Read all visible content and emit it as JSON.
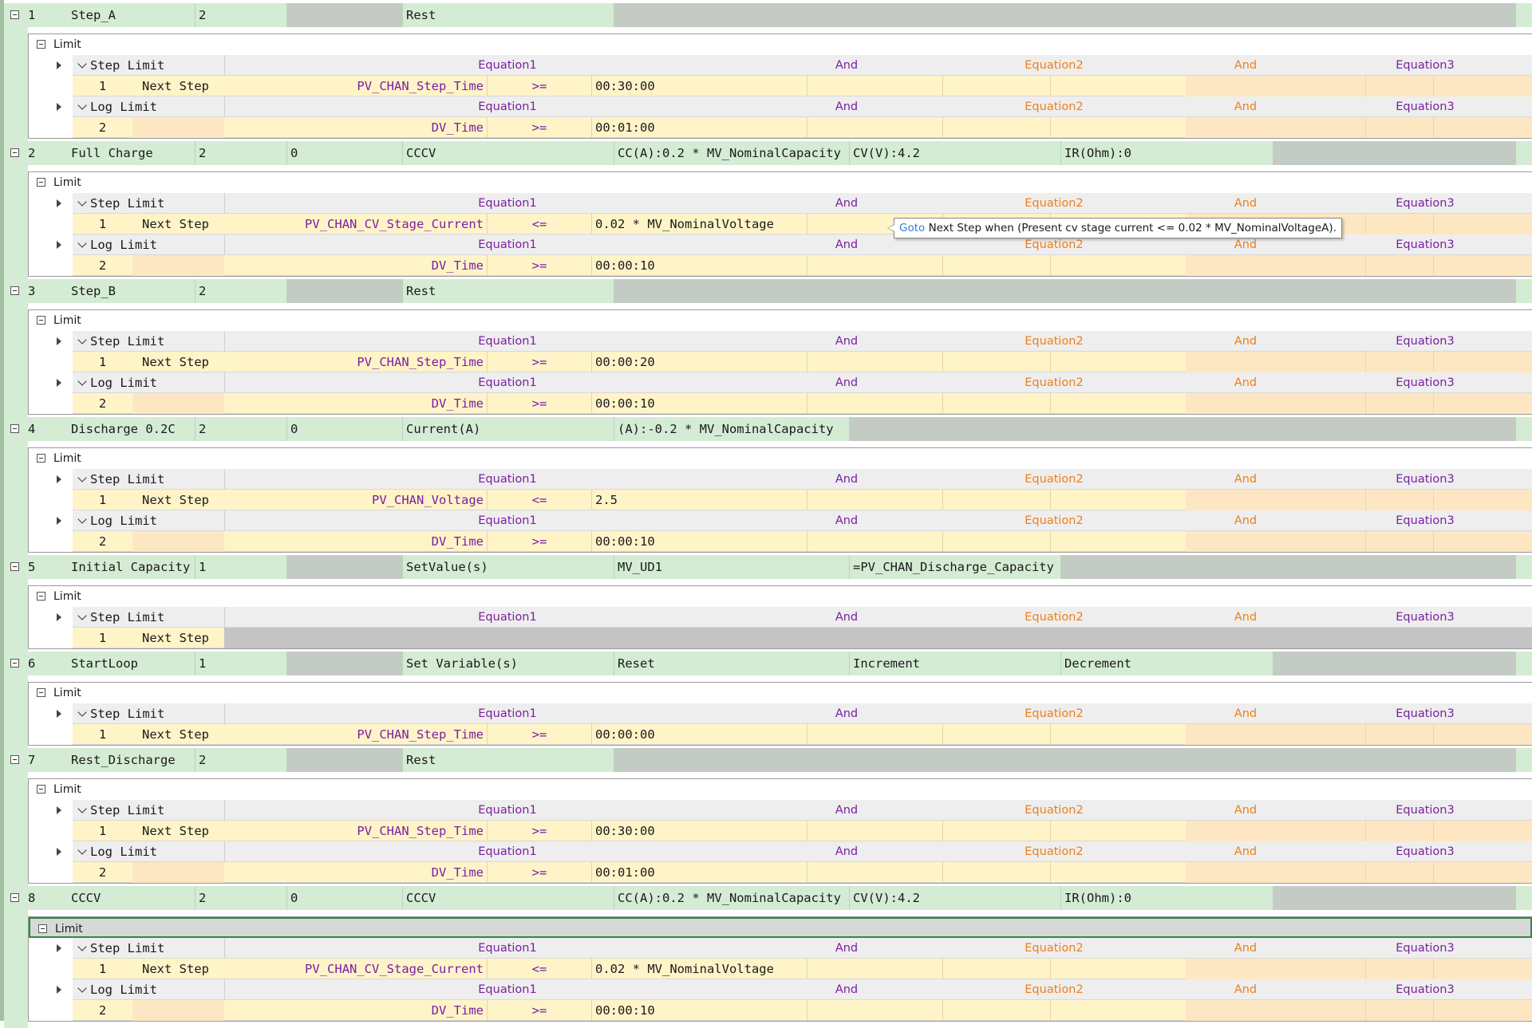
{
  "limit_label": "Limit",
  "labels": {
    "step_limit": "Step Limit",
    "log_limit": "Log Limit",
    "next_step": "Next Step",
    "equation1": "Equation1",
    "and": "And",
    "equation2": "Equation2",
    "equation3": "Equation3"
  },
  "tooltip": {
    "goto": "Goto",
    "text": " Next Step when (Present cv stage current  <= 0.02 * MV_NominalVoltageA)."
  },
  "steps": [
    {
      "num": "1",
      "name": "Step_A",
      "c2": "2",
      "c3": "",
      "c4": "Rest",
      "c5": "",
      "c6": "",
      "c7": "",
      "step_limit": {
        "idx": "1",
        "goto": "Next Step",
        "var": "PV_CHAN_Step_Time",
        "op": ">=",
        "val": "00:30:00"
      },
      "log_limit": {
        "idx": "2",
        "var": "DV_Time",
        "op": ">=",
        "val": "00:01:00"
      }
    },
    {
      "num": "2",
      "name": "Full Charge",
      "c2": "2",
      "c3": "0",
      "c4": "CCCV",
      "c5": "CC(A):0.2 * MV_NominalCapacity",
      "c6": "CV(V):4.2",
      "c7": "IR(Ohm):0",
      "step_limit": {
        "idx": "1",
        "goto": "Next Step",
        "var": "PV_CHAN_CV_Stage_Current",
        "op": "<=",
        "val": "0.02 * MV_NominalVoltage"
      },
      "log_limit": {
        "idx": "2",
        "var": "DV_Time",
        "op": ">=",
        "val": "00:00:10"
      }
    },
    {
      "num": "3",
      "name": "Step_B",
      "c2": "2",
      "c3": "",
      "c4": "Rest",
      "c5": "",
      "c6": "",
      "c7": "",
      "step_limit": {
        "idx": "1",
        "goto": "Next Step",
        "var": "PV_CHAN_Step_Time",
        "op": ">=",
        "val": "00:00:20"
      },
      "log_limit": {
        "idx": "2",
        "var": "DV_Time",
        "op": ">=",
        "val": "00:00:10"
      }
    },
    {
      "num": "4",
      "name": "Discharge 0.2C",
      "c2": "2",
      "c3": "0",
      "c4": "Current(A)",
      "c5": "(A):-0.2 * MV_NominalCapacity",
      "c6": "",
      "c7": "",
      "step_limit": {
        "idx": "1",
        "goto": "Next Step",
        "var": "PV_CHAN_Voltage",
        "op": "<=",
        "val": "2.5"
      },
      "log_limit": {
        "idx": "2",
        "var": "DV_Time",
        "op": ">=",
        "val": "00:00:10"
      }
    },
    {
      "num": "5",
      "name": "Initial Capacity",
      "c2": "1",
      "c3": "",
      "c4": "SetValue(s)",
      "c5": "MV_UD1",
      "c6": "=PV_CHAN_Discharge_Capacity",
      "c7": "",
      "step_limit": {
        "idx": "1",
        "goto": "Next Step",
        "var": "",
        "op": "",
        "val": ""
      }
    },
    {
      "num": "6",
      "name": "StartLoop",
      "c2": "1",
      "c3": "",
      "c4": "Set Variable(s)",
      "c5": "Reset",
      "c6": "Increment",
      "c7": "Decrement",
      "step_limit": {
        "idx": "1",
        "goto": "Next Step",
        "var": "PV_CHAN_Step_Time",
        "op": ">=",
        "val": "00:00:00"
      }
    },
    {
      "num": "7",
      "name": "Rest_Discharge",
      "c2": "2",
      "c3": "",
      "c4": "Rest",
      "c5": "",
      "c6": "",
      "c7": "",
      "step_limit": {
        "idx": "1",
        "goto": "Next Step",
        "var": "PV_CHAN_Step_Time",
        "op": ">=",
        "val": "00:30:00"
      },
      "log_limit": {
        "idx": "2",
        "var": "DV_Time",
        "op": ">=",
        "val": "00:01:00"
      }
    },
    {
      "num": "8",
      "name": "CCCV",
      "c2": "2",
      "c3": "0",
      "c4": "CCCV",
      "c5": "CC(A):0.2 * MV_NominalCapacity",
      "c6": "CV(V):4.2",
      "c7": "IR(Ohm):0",
      "step_limit": {
        "idx": "1",
        "goto": "Next Step",
        "var": "PV_CHAN_CV_Stage_Current",
        "op": "<=",
        "val": "0.02 * MV_NominalVoltage"
      },
      "log_limit": {
        "idx": "2",
        "var": "DV_Time",
        "op": ">=",
        "val": "00:00:10"
      }
    }
  ]
}
